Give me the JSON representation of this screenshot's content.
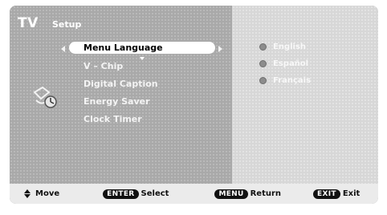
{
  "header": {
    "tv_label": "TV",
    "section": "Setup"
  },
  "menu": {
    "items": [
      {
        "label": "Menu Language"
      },
      {
        "label": "V – Chip"
      },
      {
        "label": "Digital Caption"
      },
      {
        "label": "Energy Saver"
      },
      {
        "label": "Clock Timer"
      }
    ]
  },
  "options": [
    {
      "label": "English"
    },
    {
      "label": "Español"
    },
    {
      "label": "Français"
    }
  ],
  "footer": {
    "move": "Move",
    "enter_key": "ENTER",
    "select": "Select",
    "menu_key": "MENU",
    "return": "Return",
    "exit_key": "EXIT",
    "exit": "Exit"
  },
  "icons": {
    "menu_icon": "clock-timer-icon"
  }
}
